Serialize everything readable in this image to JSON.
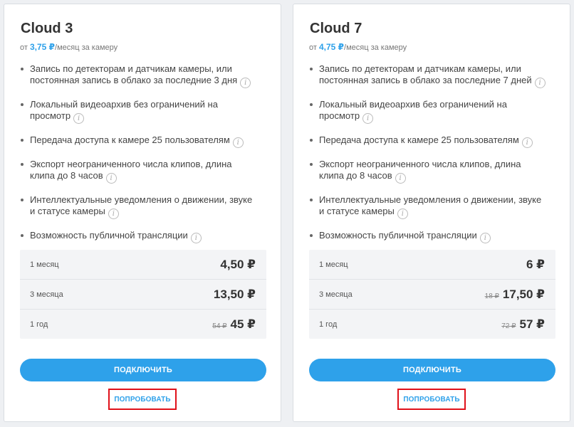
{
  "plans": [
    {
      "title": "Cloud 3",
      "price_prefix": "от",
      "price_value": "3,75 ₽",
      "price_suffix": "/месяц за камеру",
      "features": [
        "Запись по детекторам и датчикам камеры, или постоянная запись в облако за последние 3 дня",
        "Локальный видеоархив без ограничений на просмотр",
        "Передача доступа к камере 25 пользователям",
        "Экспорт неограниченного числа клипов, длина клипа до 8 часов",
        "Интеллектуальные уведомления о движении, звуке и статусе камеры",
        "Возможность публичной трансляции"
      ],
      "prices": [
        {
          "period": "1 месяц",
          "old": "",
          "new": "4,50 ₽"
        },
        {
          "period": "3 месяца",
          "old": "",
          "new": "13,50 ₽"
        },
        {
          "period": "1 год",
          "old": "54 ₽",
          "new": "45 ₽"
        }
      ],
      "connect_label": "ПОДКЛЮЧИТЬ",
      "try_label": "ПОПРОБОВАТЬ"
    },
    {
      "title": "Cloud 7",
      "price_prefix": "от",
      "price_value": "4,75 ₽",
      "price_suffix": "/месяц за камеру",
      "features": [
        "Запись по детекторам и датчикам камеры, или постоянная запись в облако за последние 7 дней",
        "Локальный видеоархив без ограничений на просмотр",
        "Передача доступа к камере 25 пользователям",
        "Экспорт неограниченного числа клипов, длина клипа до 8 часов",
        "Интеллектуальные уведомления о движении, звуке и статусе камеры",
        "Возможность публичной трансляции"
      ],
      "prices": [
        {
          "period": "1 месяц",
          "old": "",
          "new": "6 ₽"
        },
        {
          "period": "3 месяца",
          "old": "18 ₽",
          "new": "17,50 ₽"
        },
        {
          "period": "1 год",
          "old": "72 ₽",
          "new": "57 ₽"
        }
      ],
      "connect_label": "ПОДКЛЮЧИТЬ",
      "try_label": "ПОПРОБОВАТЬ"
    }
  ],
  "icons": {
    "info": "i"
  },
  "colors": {
    "accent": "#2ea1ea",
    "highlight": "#e0111a"
  }
}
